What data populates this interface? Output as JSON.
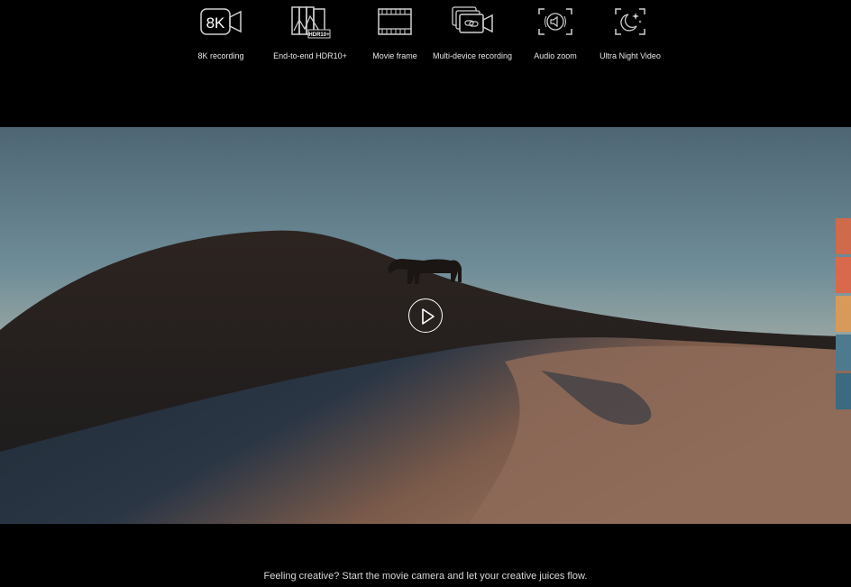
{
  "features": [
    {
      "label": "8K recording",
      "icon": "8k-camera-icon",
      "badge": "8K"
    },
    {
      "label": "End-to-end HDR10+",
      "icon": "hdr10-plus-icon",
      "badge": "HDR10+"
    },
    {
      "label": "Movie frame",
      "icon": "film-frame-icon"
    },
    {
      "label": "Multi-device recording",
      "icon": "multi-device-camera-icon"
    },
    {
      "label": "Audio zoom",
      "icon": "audio-zoom-icon"
    },
    {
      "label": "Ultra Night Video",
      "icon": "night-moon-icon"
    }
  ],
  "video": {
    "play_icon": "play-icon"
  },
  "swatches": [
    "#cf6a4c",
    "#d8694d",
    "#d89a5a",
    "#4d7a8f",
    "#3c6a80"
  ],
  "caption": "Feeling creative? Start the movie camera and let your creative juices flow."
}
